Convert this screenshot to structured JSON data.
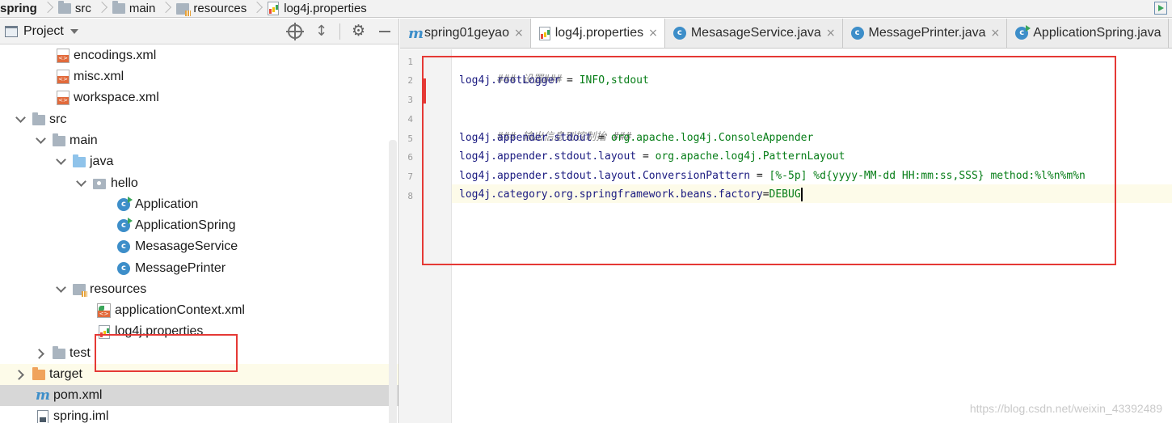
{
  "breadcrumb": {
    "items": [
      "spring",
      "src",
      "main",
      "resources",
      "log4j.properties"
    ]
  },
  "project_panel": {
    "title": "Project",
    "tree": {
      "encodings": "encodings.xml",
      "misc": "misc.xml",
      "workspace": "workspace.xml",
      "src": "src",
      "main": "main",
      "java": "java",
      "hello": "hello",
      "classes": [
        "Application",
        "ApplicationSpring",
        "MesasageService",
        "MessagePrinter"
      ],
      "resources": "resources",
      "appctx": "applicationContext.xml",
      "log4j": "log4j.properties",
      "test": "test",
      "target": "target",
      "pom": "pom.xml",
      "iml": "spring.iml"
    }
  },
  "editor": {
    "tabs": [
      {
        "label": "spring01geyao",
        "icon": "maven-icon"
      },
      {
        "label": "log4j.properties",
        "icon": "properties-icon"
      },
      {
        "label": "MesasageService.java",
        "icon": "class-icon"
      },
      {
        "label": "MessagePrinter.java",
        "icon": "class-icon"
      },
      {
        "label": "ApplicationSpring.java",
        "icon": "class-icon"
      }
    ],
    "close_glyph": "×",
    "line_numbers": [
      "1",
      "2",
      "3",
      "4",
      "5",
      "6",
      "7",
      "8"
    ],
    "lines": {
      "l1": "### 设置###",
      "l2_key": "log4j.rootLogger",
      "l2_eq": " = ",
      "l2_val": "INFO,stdout",
      "l4": "### 输出信息到控制抬 ###",
      "l5_key": "log4j.appender.stdout",
      "l5_eq": " = ",
      "l5_val": "org.apache.log4j.ConsoleAppender",
      "l6_key": "log4j.appender.stdout.layout",
      "l6_eq": " = ",
      "l6_val": "org.apache.log4j.PatternLayout",
      "l7_key": "log4j.appender.stdout.layout.ConversionPattern",
      "l7_eq": " = ",
      "l7_val": "[%-5p] %d{yyyy-MM-dd HH:mm:ss,SSS} method:%l%n%m%n",
      "l8_key": "log4j.category.org.springframework.beans.factory",
      "l8_eq": "=",
      "l8_val": "DEBUG"
    }
  },
  "watermark": "https://blog.csdn.net/weixin_43392489",
  "colors": {
    "highlight_box": "#e53935",
    "comment": "#8c8c8c",
    "key": "#1a1a80",
    "value": "#067d17"
  }
}
